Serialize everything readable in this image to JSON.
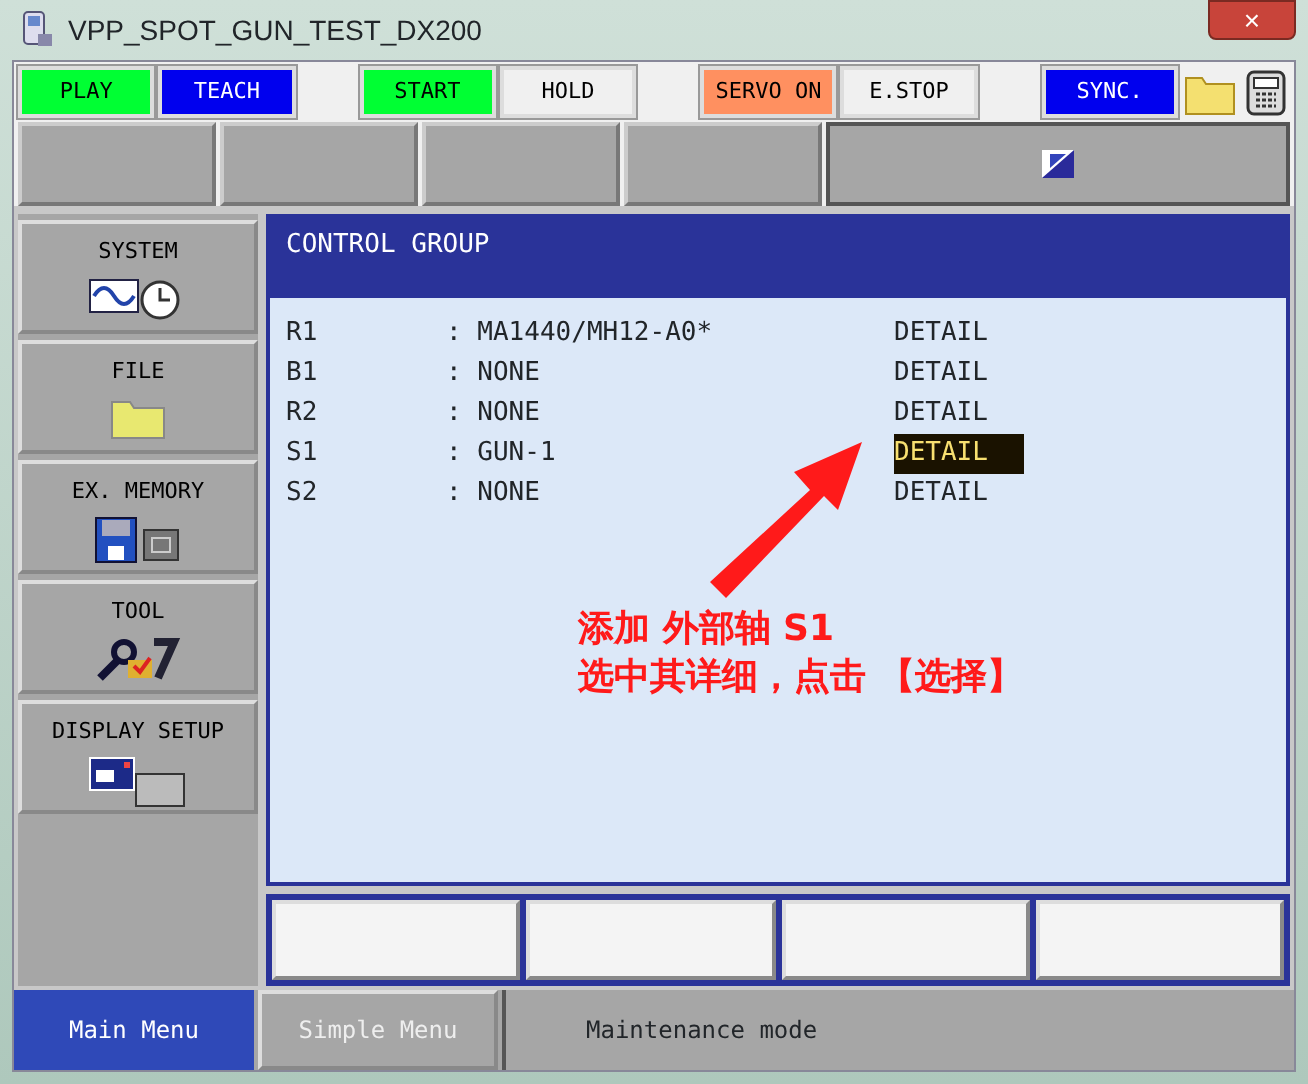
{
  "window": {
    "title": "VPP_SPOT_GUN_TEST_DX200",
    "close": "×"
  },
  "status_buttons": [
    {
      "label": "PLAY",
      "color": "#00ff33"
    },
    {
      "label": "TEACH",
      "color": "#0000ee"
    },
    {
      "kind": "gap"
    },
    {
      "label": "START",
      "color": "#00ff33"
    },
    {
      "label": "HOLD",
      "color": "#f0f0f0"
    },
    {
      "kind": "gap"
    },
    {
      "label": "SERVO ON",
      "color": "#ff9060"
    },
    {
      "label": "E.STOP",
      "color": "#f0f0f0"
    },
    {
      "kind": "gap"
    },
    {
      "label": "SYNC.",
      "color": "#0000ee"
    }
  ],
  "side_menu": [
    {
      "label": "SYSTEM"
    },
    {
      "label": "FILE"
    },
    {
      "label": "EX. MEMORY"
    },
    {
      "label": "TOOL"
    },
    {
      "label": "DISPLAY SETUP"
    }
  ],
  "panel": {
    "title": "CONTROL GROUP",
    "rows": [
      {
        "group": "R1",
        "value": ": MA1440/MH12-A0*",
        "action": "DETAIL",
        "selected": false
      },
      {
        "group": "B1",
        "value": ": NONE",
        "action": "DETAIL",
        "selected": false
      },
      {
        "group": "R2",
        "value": ": NONE",
        "action": "DETAIL",
        "selected": false
      },
      {
        "group": "S1",
        "value": ": GUN-1",
        "action": "DETAIL",
        "selected": true
      },
      {
        "group": "S2",
        "value": ": NONE",
        "action": "DETAIL",
        "selected": false
      }
    ]
  },
  "annotation": {
    "lines": [
      "添加 外部轴 S1",
      "选中其详细，点击 【选择】"
    ]
  },
  "bottom_tabs": [
    {
      "label": "Main Menu",
      "selected": true
    },
    {
      "label": "Simple Menu",
      "selected": false
    }
  ],
  "status_bar": "Maintenance mode"
}
